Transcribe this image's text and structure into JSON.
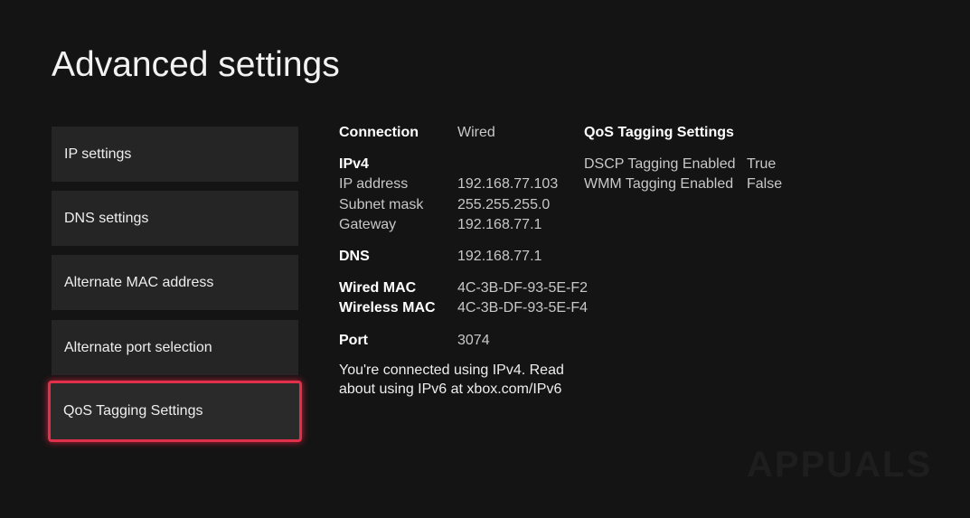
{
  "title": "Advanced settings",
  "menu": [
    "IP settings",
    "DNS settings",
    "Alternate MAC address",
    "Alternate port selection",
    "QoS Tagging Settings"
  ],
  "info": {
    "connection_label": "Connection",
    "connection_value": "Wired",
    "ipv4_label": "IPv4",
    "ip_label": "IP address",
    "ip_value": "192.168.77.103",
    "subnet_label": "Subnet mask",
    "subnet_value": "255.255.255.0",
    "gateway_label": "Gateway",
    "gateway_value": "192.168.77.1",
    "dns_label": "DNS",
    "dns_value": "192.168.77.1",
    "wired_mac_label": "Wired MAC",
    "wired_mac_value": "4C-3B-DF-93-5E-F2",
    "wireless_mac_label": "Wireless MAC",
    "wireless_mac_value": "4C-3B-DF-93-5E-F4",
    "port_label": "Port",
    "port_value": "3074",
    "note": "You're connected using IPv4. Read about using IPv6 at xbox.com/IPv6"
  },
  "qos": {
    "heading": "QoS Tagging Settings",
    "dscp_label": "DSCP Tagging Enabled",
    "dscp_value": "True",
    "wmm_label": "WMM Tagging Enabled",
    "wmm_value": "False"
  },
  "watermark": "APPUALS"
}
